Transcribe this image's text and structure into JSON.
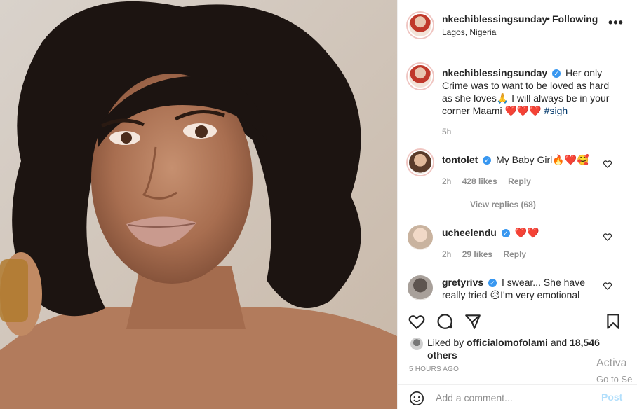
{
  "header": {
    "username": "nkechiblessingsunday",
    "dot": "•",
    "follow_label": "Following",
    "location": "Lagos, Nigeria",
    "more": "•••"
  },
  "caption": {
    "username": "nkechiblessingsunday",
    "text": "Her only Crime was to want to be loved as hard as she loves🙏 I will always be in your corner Maami",
    "hearts": "❤️❤️❤️",
    "hashtag": "#sigh",
    "time": "5h"
  },
  "comments": [
    {
      "username": "tontolet",
      "text": "My Baby Girl🔥❤️🥰",
      "time": "2h",
      "likes": "428 likes",
      "reply": "Reply",
      "view_replies": "View replies (68)"
    },
    {
      "username": "ucheelendu",
      "text": "❤️❤️",
      "time": "2h",
      "likes": "29 likes",
      "reply": "Reply"
    },
    {
      "username": "gretyrivs",
      "text": "I swear... She have really tried 😥I'm very emotional"
    }
  ],
  "likes": {
    "prefix": "Liked by",
    "liker": "officialomofolami",
    "and": "and",
    "others": "18,546 others"
  },
  "post_time": "5 HOURS AGO",
  "comment_box": {
    "placeholder": "Add a comment...",
    "post_label": "Post"
  },
  "watermark": {
    "line1": "Activa",
    "line2": "Go to Se"
  },
  "colors": {
    "verified": "#3897f0",
    "heart": "#e0245e",
    "hashtag": "#00376b",
    "muted": "#8e8e8e",
    "post_disabled": "#b2dffc"
  }
}
